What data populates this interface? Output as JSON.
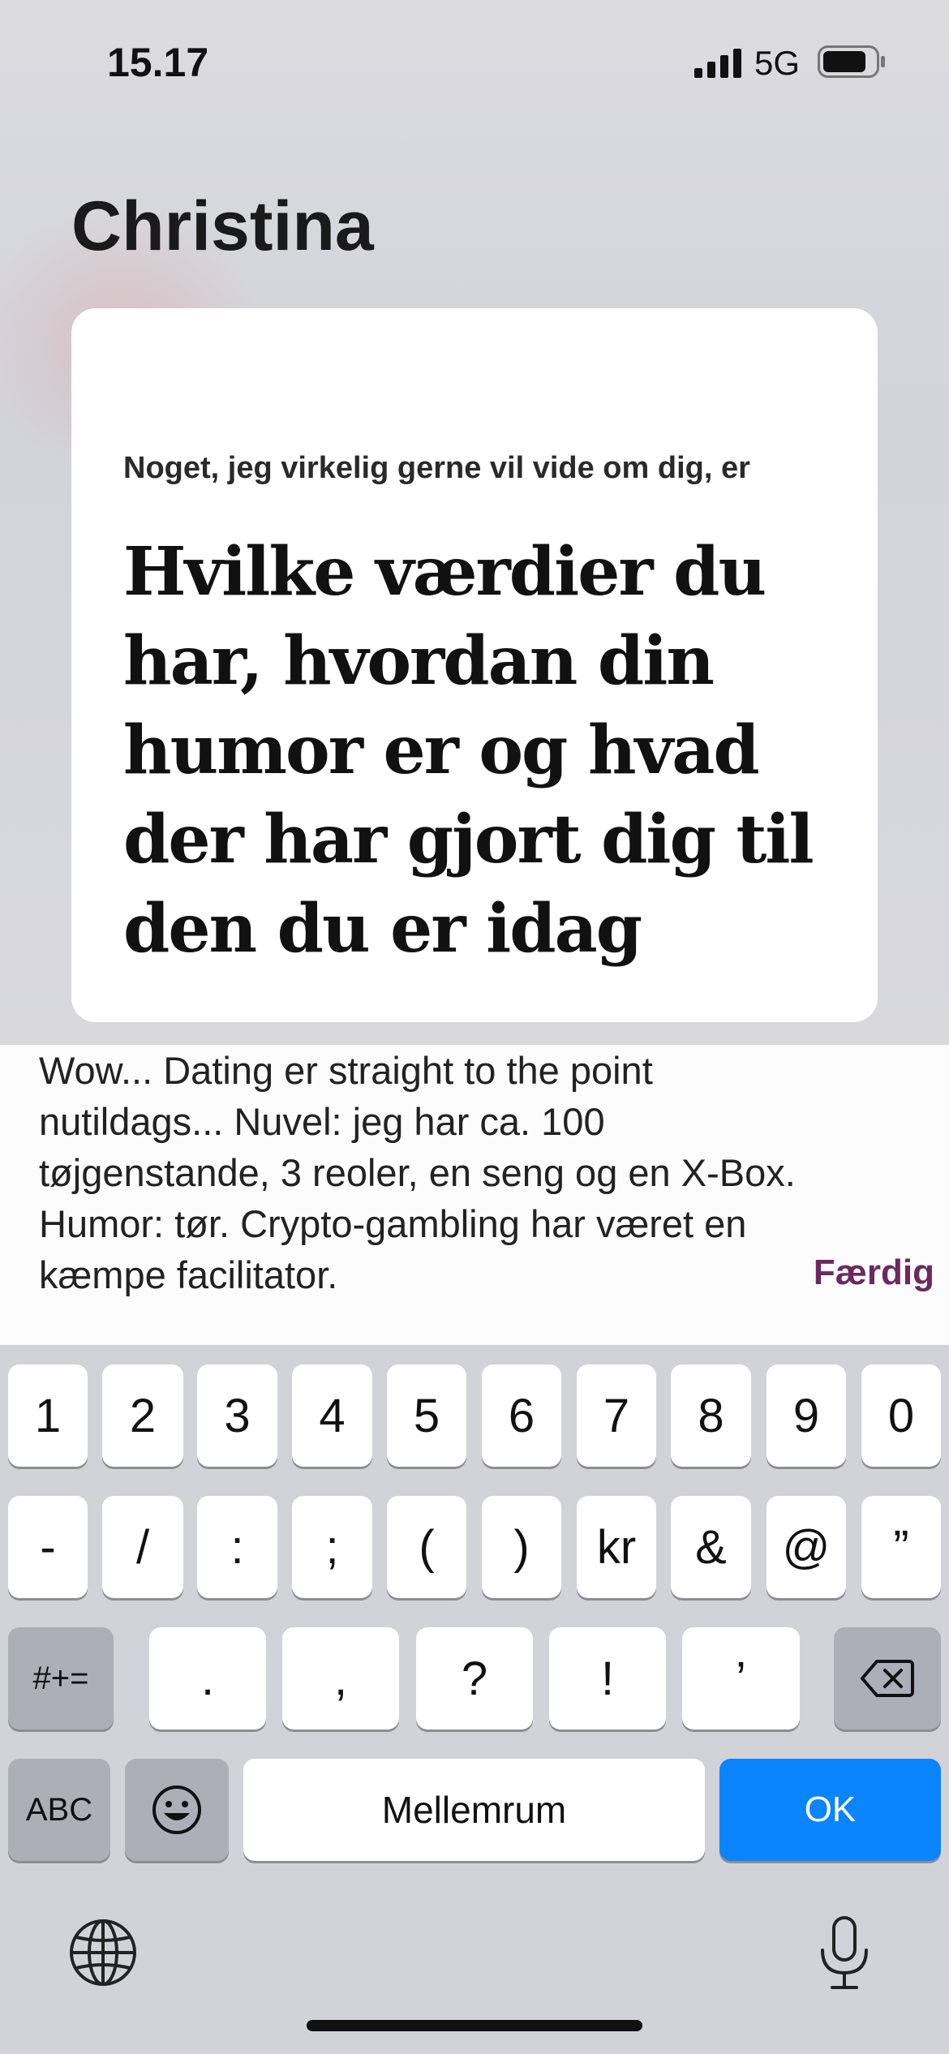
{
  "status_bar": {
    "time": "15.17",
    "network": "5G",
    "signal_icon": "signal-bars-icon",
    "battery_icon": "battery-icon"
  },
  "profile": {
    "name": "Christina"
  },
  "prompt": {
    "label": "Noget, jeg virkelig gerne vil vide om dig, er",
    "question": "Hvilke værdier du har, hvordan din humor er og hvad der har gjort dig til den du er idag"
  },
  "answer": {
    "text": "Wow... Dating er straight to the point nutildags... Nuvel: jeg har ca. 100 tøjgenstande, 3 reoler, en seng og en X-Box. Humor: tør. Crypto-gambling har været en kæmpe facilitator.",
    "done_label": "Færdig",
    "done_color": "#6b2a5f"
  },
  "keyboard": {
    "row1": [
      "1",
      "2",
      "3",
      "4",
      "5",
      "6",
      "7",
      "8",
      "9",
      "0"
    ],
    "row2": [
      "-",
      "/",
      ":",
      ";",
      "(",
      ")",
      "kr",
      "&",
      "@",
      "”"
    ],
    "row3": [
      "#+=",
      ".",
      ",",
      "?",
      "!",
      "’"
    ],
    "backspace_icon": "backspace-icon",
    "abc": "ABC",
    "emoji_icon": "emoji-icon",
    "space": "Mellemrum",
    "ok": "OK",
    "ok_color": "#0a84ff",
    "globe_icon": "globe-icon",
    "mic_icon": "microphone-icon"
  }
}
